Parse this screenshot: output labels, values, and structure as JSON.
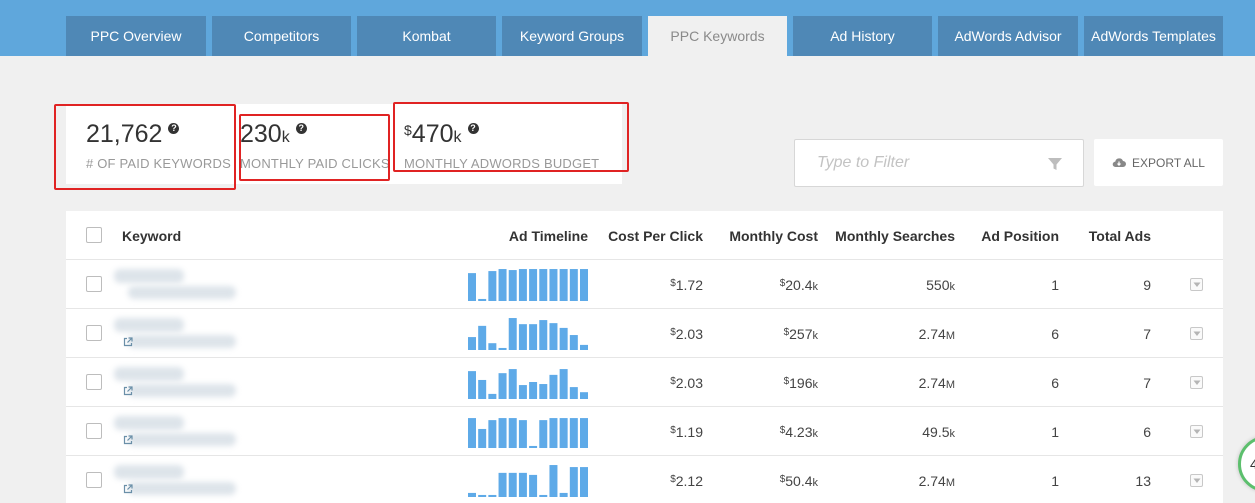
{
  "tabs": [
    {
      "label": "PPC Overview",
      "active": false
    },
    {
      "label": "Competitors",
      "active": false
    },
    {
      "label": "Kombat",
      "active": false
    },
    {
      "label": "Keyword Groups",
      "active": false
    },
    {
      "label": "PPC Keywords",
      "active": true
    },
    {
      "label": "Ad History",
      "active": false
    },
    {
      "label": "AdWords Advisor",
      "active": false
    },
    {
      "label": "AdWords Templates",
      "active": false
    }
  ],
  "stats": {
    "paid_keywords": {
      "value": "21,762",
      "label": "# OF PAID KEYWORDS"
    },
    "paid_clicks": {
      "value": "230",
      "suffix": "k",
      "label": "MONTHLY PAID CLICKS"
    },
    "budget": {
      "prefix": "$",
      "value": "470",
      "suffix": "k",
      "label": "MONTHLY ADWORDS BUDGET"
    }
  },
  "help_icon": "question-circle-icon",
  "filter": {
    "placeholder": "Type to Filter",
    "icon": "funnel-icon"
  },
  "export": {
    "label": "EXPORT ALL",
    "icon": "cloud-download-icon"
  },
  "table": {
    "headers": {
      "keyword": "Keyword",
      "timeline": "Ad Timeline",
      "cpc": "Cost Per Click",
      "monthly_cost": "Monthly Cost",
      "monthly_searches": "Monthly Searches",
      "ad_position": "Ad Position",
      "total_ads": "Total Ads"
    },
    "rows": [
      {
        "cpc": "1.72",
        "cost": "20.4",
        "cost_suffix": "k",
        "searches": "550",
        "searches_suffix": "k",
        "position": "1",
        "ads": "9",
        "timeline": [
          0.82,
          0.06,
          0.88,
          0.94,
          0.91,
          0.94,
          0.94,
          0.94,
          0.94,
          0.94,
          0.94,
          0.94
        ]
      },
      {
        "cpc": "2.03",
        "cost": "257",
        "cost_suffix": "k",
        "searches": "2.74",
        "searches_suffix": "M",
        "position": "6",
        "ads": "7",
        "timeline": [
          0.38,
          0.71,
          0.2,
          0.06,
          0.94,
          0.76,
          0.76,
          0.88,
          0.79,
          0.65,
          0.44,
          0.15
        ]
      },
      {
        "cpc": "2.03",
        "cost": "196",
        "cost_suffix": "k",
        "searches": "2.74",
        "searches_suffix": "M",
        "position": "6",
        "ads": "7",
        "timeline": [
          0.82,
          0.56,
          0.15,
          0.76,
          0.88,
          0.41,
          0.5,
          0.44,
          0.71,
          0.88,
          0.35,
          0.2
        ]
      },
      {
        "cpc": "1.19",
        "cost": "4.23",
        "cost_suffix": "k",
        "searches": "49.5",
        "searches_suffix": "k",
        "position": "1",
        "ads": "6",
        "timeline": [
          0.88,
          0.56,
          0.82,
          0.88,
          0.88,
          0.82,
          0.06,
          0.82,
          0.88,
          0.88,
          0.88,
          0.88
        ]
      },
      {
        "cpc": "2.12",
        "cost": "50.4",
        "cost_suffix": "k",
        "searches": "2.74",
        "searches_suffix": "M",
        "position": "1",
        "ads": "13",
        "timeline": [
          0.12,
          0.06,
          0.06,
          0.71,
          0.71,
          0.71,
          0.65,
          0.06,
          0.94,
          0.12,
          0.88,
          0.88
        ]
      }
    ]
  },
  "colors": {
    "tabbar": "#5fa7dc",
    "tab": "#4f88b6",
    "bar": "#5eaae8",
    "highlight": "#e02323"
  }
}
